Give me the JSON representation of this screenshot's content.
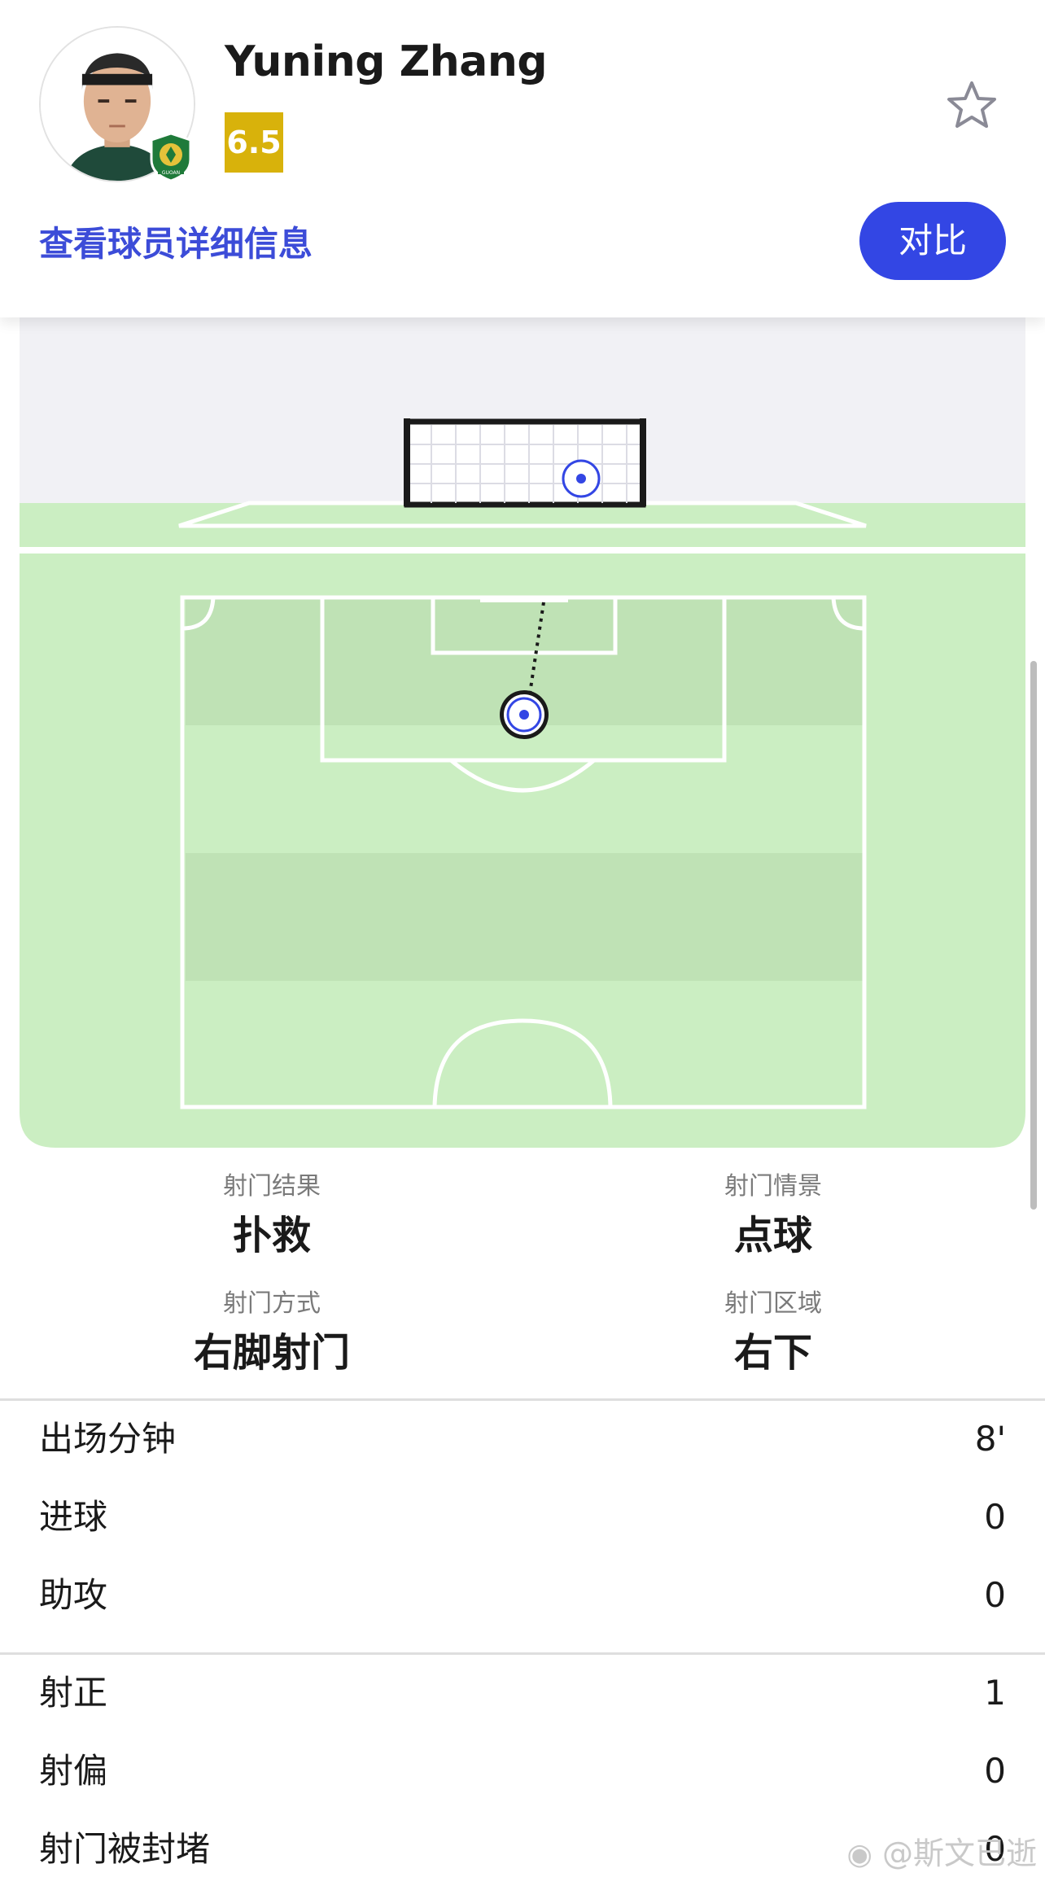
{
  "player": {
    "name": "Yuning Zhang",
    "rating": "6.5",
    "details_link": "查看球员详细信息",
    "compare_label": "对比"
  },
  "club_badge": {
    "text": "GUOAN"
  },
  "icons": {
    "favorite": "star-outline-icon",
    "avatar": "player-avatar",
    "club": "club-badge-icon"
  },
  "colors": {
    "accent": "#3346e4",
    "link": "#3c4cd8",
    "rating_bg": "#d8b20b",
    "pitch_light": "#cbeec2",
    "pitch_dark": "#bfe2b5",
    "sky": "#f1f1f5"
  },
  "shot_info": [
    {
      "label": "射门结果",
      "value": "扑救"
    },
    {
      "label": "射门情景",
      "value": "点球"
    },
    {
      "label": "射门方式",
      "value": "右脚射门"
    },
    {
      "label": "射门区域",
      "value": "右下"
    }
  ],
  "stats_group1": [
    {
      "label": "出场分钟",
      "value": "8'"
    },
    {
      "label": "进球",
      "value": "0"
    },
    {
      "label": "助攻",
      "value": "0"
    }
  ],
  "stats_group2": [
    {
      "label": "射正",
      "value": "1"
    },
    {
      "label": "射偏",
      "value": "0"
    },
    {
      "label": "射门被封堵",
      "value": "0"
    }
  ],
  "watermark": "@斯文已逝"
}
